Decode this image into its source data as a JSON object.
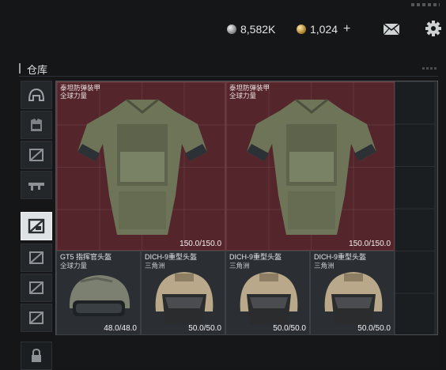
{
  "top_bar": {
    "silver_amount": "8,582K",
    "gold_amount": "1,024",
    "plus_label": "+",
    "icons": [
      "silver-coin-icon",
      "gold-coin-icon",
      "mail-icon",
      "gear-icon"
    ]
  },
  "warehouse": {
    "title": "仓库"
  },
  "tabs": [
    {
      "icon": "helmet-icon",
      "active": false
    },
    {
      "icon": "vest-icon",
      "active": false
    },
    {
      "icon": "category-icon",
      "active": false
    },
    {
      "icon": "weapon-icon",
      "active": false
    },
    {
      "icon": "category-icon",
      "active": true
    },
    {
      "icon": "category-icon",
      "active": false
    },
    {
      "icon": "category-icon",
      "active": false
    },
    {
      "icon": "category-icon",
      "active": false
    },
    {
      "icon": "lock-icon",
      "active": false
    }
  ],
  "items": [
    {
      "name": "泰坦防弹装甲",
      "sub": "全球力量",
      "durability": "150.0/150.0",
      "kind": "armor"
    },
    {
      "name": "泰坦防弹装甲",
      "sub": "全球力量",
      "durability": "150.0/150.0",
      "kind": "armor"
    },
    {
      "name": "GT5 指挥官头盔",
      "sub": "全球力量",
      "durability": "48.0/48.0",
      "kind": "helmet"
    },
    {
      "name": "DICH-9重型头盔",
      "sub": "三角洲",
      "durability": "50.0/50.0",
      "kind": "helmet"
    },
    {
      "name": "DICH-9重型头盔",
      "sub": "三角洲",
      "durability": "50.0/50.0",
      "kind": "helmet"
    },
    {
      "name": "DICH-9重型头盔",
      "sub": "三角洲",
      "durability": "50.0/50.0",
      "kind": "helmet"
    }
  ],
  "colors": {
    "armor_bg": "#54252a",
    "helmet_bg": "#2b2f33",
    "active_tab": "#dfe2e4"
  }
}
